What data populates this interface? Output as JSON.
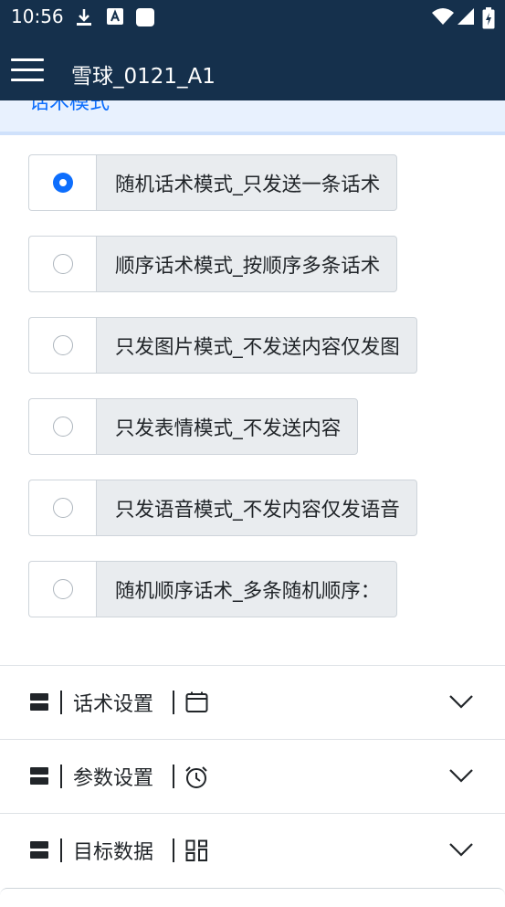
{
  "status_bar": {
    "time": "10:56",
    "icons": [
      "download-icon",
      "font-a-icon",
      "square-app-icon",
      "wifi-icon",
      "signal-icon",
      "battery-charging-icon"
    ]
  },
  "app_bar": {
    "title": "雪球_0121_A1",
    "menu_icon": "hamburger-menu-icon"
  },
  "peek_section": {
    "label": "话术模式"
  },
  "modes": {
    "selected_index": 0,
    "items": [
      {
        "label": "随机话术模式_只发送一条话术",
        "checked": true
      },
      {
        "label": "顺序话术模式_按顺序多条话术",
        "checked": false
      },
      {
        "label": "只发图片模式_不发送内容仅发图",
        "checked": false
      },
      {
        "label": "只发表情模式_不发送内容",
        "checked": false
      },
      {
        "label": "只发语音模式_不发内容仅发语音",
        "checked": false
      },
      {
        "label": "随机顺序话术_多条随机顺序：",
        "checked": false
      }
    ]
  },
  "accordions": [
    {
      "label": "话术设置",
      "icon": "calendar-icon",
      "expand_icon": "chevron-down-icon"
    },
    {
      "label": "参数设置",
      "icon": "alarm-clock-icon",
      "expand_icon": "chevron-down-icon"
    },
    {
      "label": "目标数据",
      "icon": "grid-squares-icon",
      "expand_icon": "chevron-down-icon"
    }
  ],
  "colors": {
    "app_bar": "#15304c",
    "accent": "#0d6efd",
    "label_bg": "#e9ecef",
    "border": "#ced4da"
  }
}
